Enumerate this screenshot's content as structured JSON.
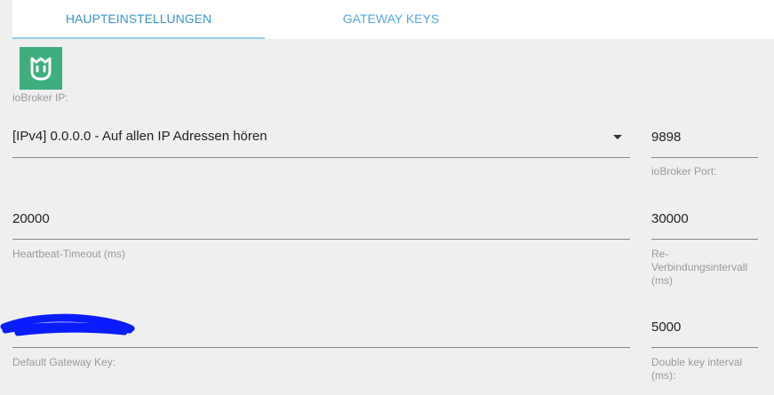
{
  "tabs": {
    "main_label": "HAUPTEINSTELLUNGEN",
    "gateway_label": "GATEWAY KEYS"
  },
  "logo": {
    "icon": "mi-home-logo",
    "color": "#3fae7e"
  },
  "fields": {
    "iobroker_ip": {
      "label": "ioBroker IP:",
      "value": "[IPv4] 0.0.0.0 - Auf allen IP Adressen hören"
    },
    "iobroker_port": {
      "label": "ioBroker Port:",
      "value": "9898"
    },
    "heartbeat_timeout": {
      "label": "Heartbeat-Timeout (ms)",
      "value": "20000"
    },
    "reconnect_interval": {
      "label_line1": "Re-",
      "label_line2": "Verbindungsintervall",
      "label_line3": "(ms)",
      "value": "30000"
    },
    "default_gateway_key": {
      "label": "Default Gateway Key:",
      "value": ""
    },
    "double_key_interval": {
      "label_line1": "Double key interval",
      "label_line2": "(ms):",
      "value": "5000"
    }
  },
  "colors": {
    "accent": "#3a94c8",
    "redaction": "#0a1cff"
  }
}
